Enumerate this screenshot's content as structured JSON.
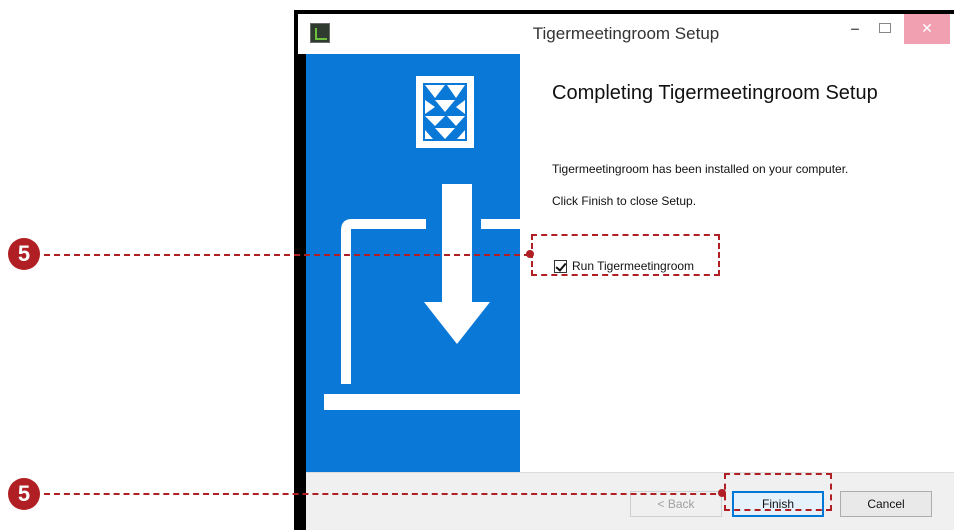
{
  "window": {
    "title": "Tigermeetingroom Setup",
    "controls": {
      "minimize": "‒",
      "close": "✕"
    }
  },
  "main": {
    "heading": "Completing Tigermeetingroom Setup",
    "line1": "Tigermeetingroom has been installed on your computer.",
    "line2": "Click Finish to close Setup.",
    "run_checkbox": {
      "label": "Run Tigermeetingroom",
      "checked": true
    }
  },
  "footer": {
    "back_label": "< Back",
    "finish_label": "Finish",
    "cancel_label": "Cancel"
  },
  "annotations": {
    "step1": "5",
    "step2": "5"
  },
  "colors": {
    "accent_blue": "#0a78d7",
    "callout_red": "#b01f24"
  }
}
